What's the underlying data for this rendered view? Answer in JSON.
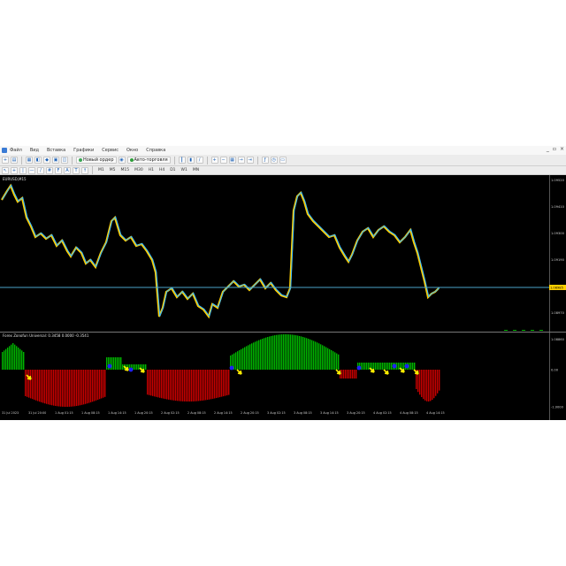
{
  "menu": {
    "items": [
      "Файл",
      "Вид",
      "Вставка",
      "Графики",
      "Сервис",
      "Окно",
      "Справка"
    ]
  },
  "toolbar": {
    "algo_label": "Новый ордер",
    "auto_label": "Авто-торговля",
    "timeframes": [
      "M1",
      "M5",
      "M15",
      "M30",
      "H1",
      "H4",
      "D1",
      "W1",
      "MN"
    ]
  },
  "chart": {
    "symbol_label": "EURUSD,M15",
    "indicator_label": "Forex Zonofun Universal: 0.3458 0.0000 -0.3541",
    "price_ticks": [
      "1.09520",
      "1.09410",
      "1.09300",
      "1.09190",
      "1.09080",
      "1.08970",
      "1.08860"
    ],
    "current_price": "1.08985",
    "osc_ticks": [
      "",
      "0.00",
      "-1.0000"
    ],
    "time_ticks": [
      "31 Jul 2023",
      "31 Jul 20:00",
      "1 Aug 01:15",
      "1 Aug 08:15",
      "1 Aug 14:15",
      "1 Aug 20:15",
      "2 Aug 02:15",
      "2 Aug 08:15",
      "2 Aug 14:15",
      "2 Aug 20:15",
      "3 Aug 02:15",
      "3 Aug 08:15",
      "3 Aug 14:15",
      "3 Aug 20:15",
      "4 Aug 02:15",
      "4 Aug 08:15",
      "4 Aug 14:15"
    ]
  },
  "colors": {
    "bull": "#00b400",
    "bear": "#c80000",
    "price_line": "#ffd000",
    "price_line2": "#35b6ff",
    "hline": "#4aa3c8",
    "arrow": "#ffee00",
    "marker": "#2020ff"
  }
}
